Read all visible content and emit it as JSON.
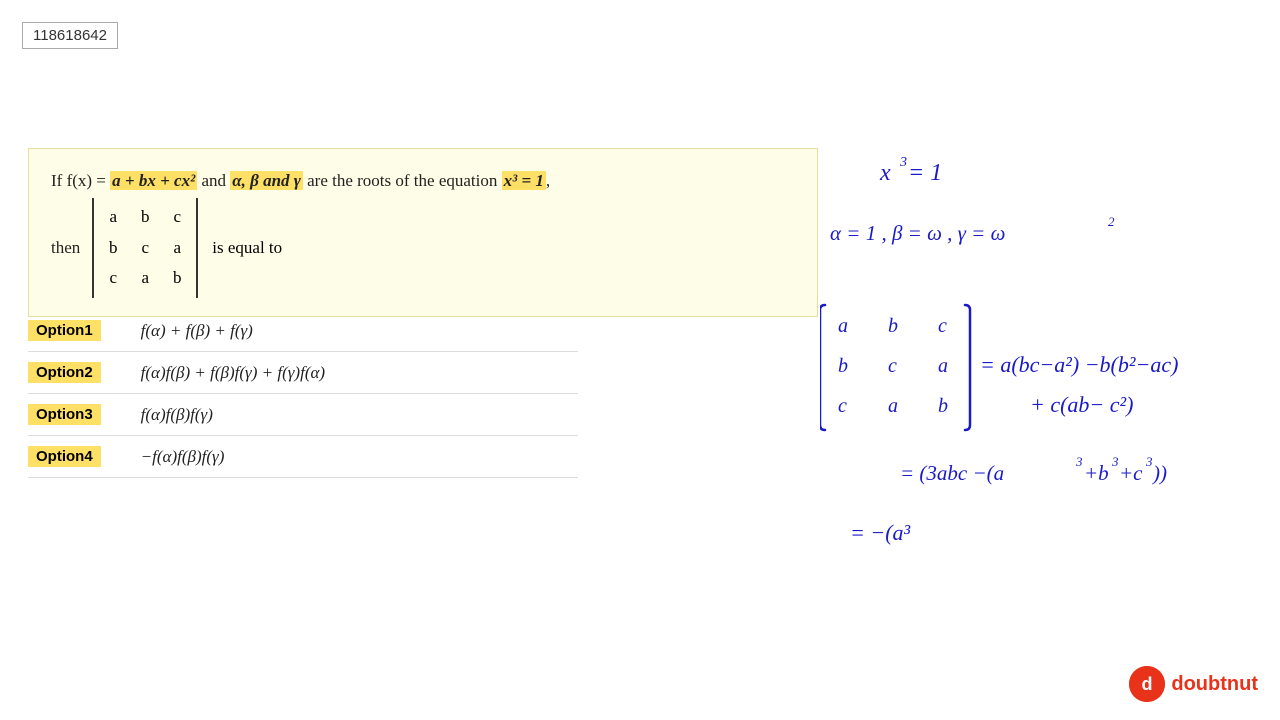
{
  "id_box": {
    "value": "118618642"
  },
  "question": {
    "line1_prefix": "If f(x)  = ",
    "highlight1": "a + bx + cx²",
    "line1_middle": " and ",
    "highlight2": "α, β and γ",
    "line1_suffix": " are the roots of the equation ",
    "highlight3": "x³ = 1",
    "line1_end": ",",
    "then_label": "then",
    "matrix": [
      [
        "a",
        "b",
        "c"
      ],
      [
        "b",
        "c",
        "a"
      ],
      [
        "c",
        "a",
        "b"
      ]
    ],
    "is_equal_to": "is equal to"
  },
  "options": [
    {
      "label": "Option1",
      "formula": "f(α) + f(β) + f(γ)"
    },
    {
      "label": "Option2",
      "formula": "f(α)f(β) + f(β)f(γ) + f(γ)f(α)"
    },
    {
      "label": "Option3",
      "formula": "f(α)f(β)f(γ)"
    },
    {
      "label": "Option4",
      "formula": "−f(α)f(β)f(γ)"
    }
  ],
  "handwritten": {
    "line1": "x³ = 1",
    "line2": "α = 1,  β = ω,  γ = ω²",
    "matrix_label": "determinant expansion",
    "expansion1": "= a(bc−a²) −b(b²−ac)",
    "expansion2": "+ c(ab− c²)",
    "simplify1": "= (3abc−(a³+b³+c³))",
    "simplify2": "= −(a³"
  },
  "logo": {
    "icon_text": "d",
    "text": "doubtnut"
  }
}
